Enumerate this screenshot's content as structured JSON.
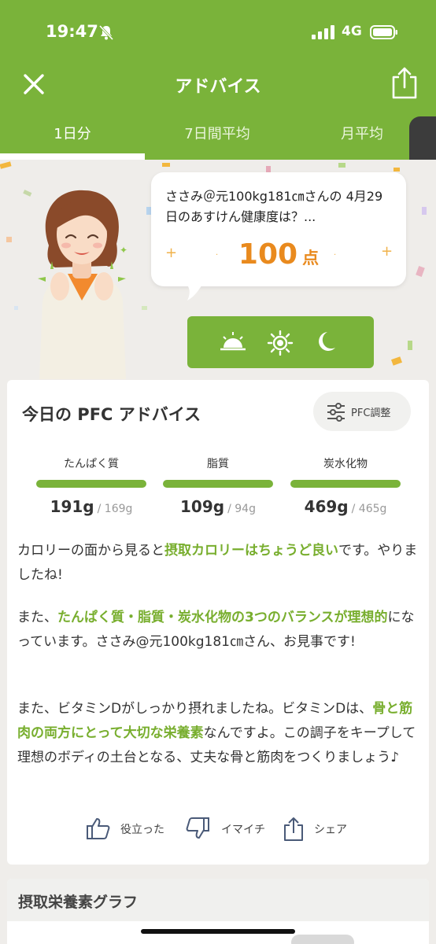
{
  "status_bar": {
    "time": "19:47",
    "network": "4G"
  },
  "navbar": {
    "title": "アドバイス"
  },
  "tabs": [
    {
      "label": "1日分",
      "active": true
    },
    {
      "label": "7日間平均",
      "active": false
    },
    {
      "label": "月平均",
      "active": false
    }
  ],
  "speech": {
    "question": "ささみ＠元100kg181㎝さんの 4月29日のあすけん健康度は？...",
    "score": "100",
    "score_unit": "点"
  },
  "meal_times": [
    "morning-icon",
    "noon-icon",
    "night-icon"
  ],
  "advice": {
    "title": "今日の PFC アドバイス",
    "pfc_button": "PFC調整",
    "nutrients": [
      {
        "name": "たんぱく質",
        "value": "191g",
        "target": "/ 169g"
      },
      {
        "name": "脂質",
        "value": "109g",
        "target": "/ 94g"
      },
      {
        "name": "炭水化物",
        "value": "469g",
        "target": "/ 465g"
      }
    ],
    "para1": {
      "pre": "カロリーの面から見ると",
      "hl": "摂取カロリーはちょうど良い",
      "post": "です。やりましたね!"
    },
    "para2": {
      "pre": "また、",
      "hl": "たんぱく質・脂質・炭水化物の3つのバランスが理想的",
      "post": "になっています。ささみ@元100kg181㎝さん、お見事です!"
    },
    "para3": {
      "pre": "また、ビタミンDがしっかり摂れましたね。ビタミンDは、",
      "hl": "骨と筋肉の両方にとって大切な栄養素",
      "post": "なんですよ。この調子をキープして理想のボディの土台となる、丈夫な骨と筋肉をつくりましょう♪"
    },
    "actions": {
      "helpful": "役立った",
      "not_good": "イマイチ",
      "share": "シェア"
    }
  },
  "nutrient_graph": {
    "title": "摂取栄養素グラフ"
  },
  "colors": {
    "accent": "#7ab33a",
    "score": "#e98a1e",
    "highlight": "#78ae2e"
  }
}
